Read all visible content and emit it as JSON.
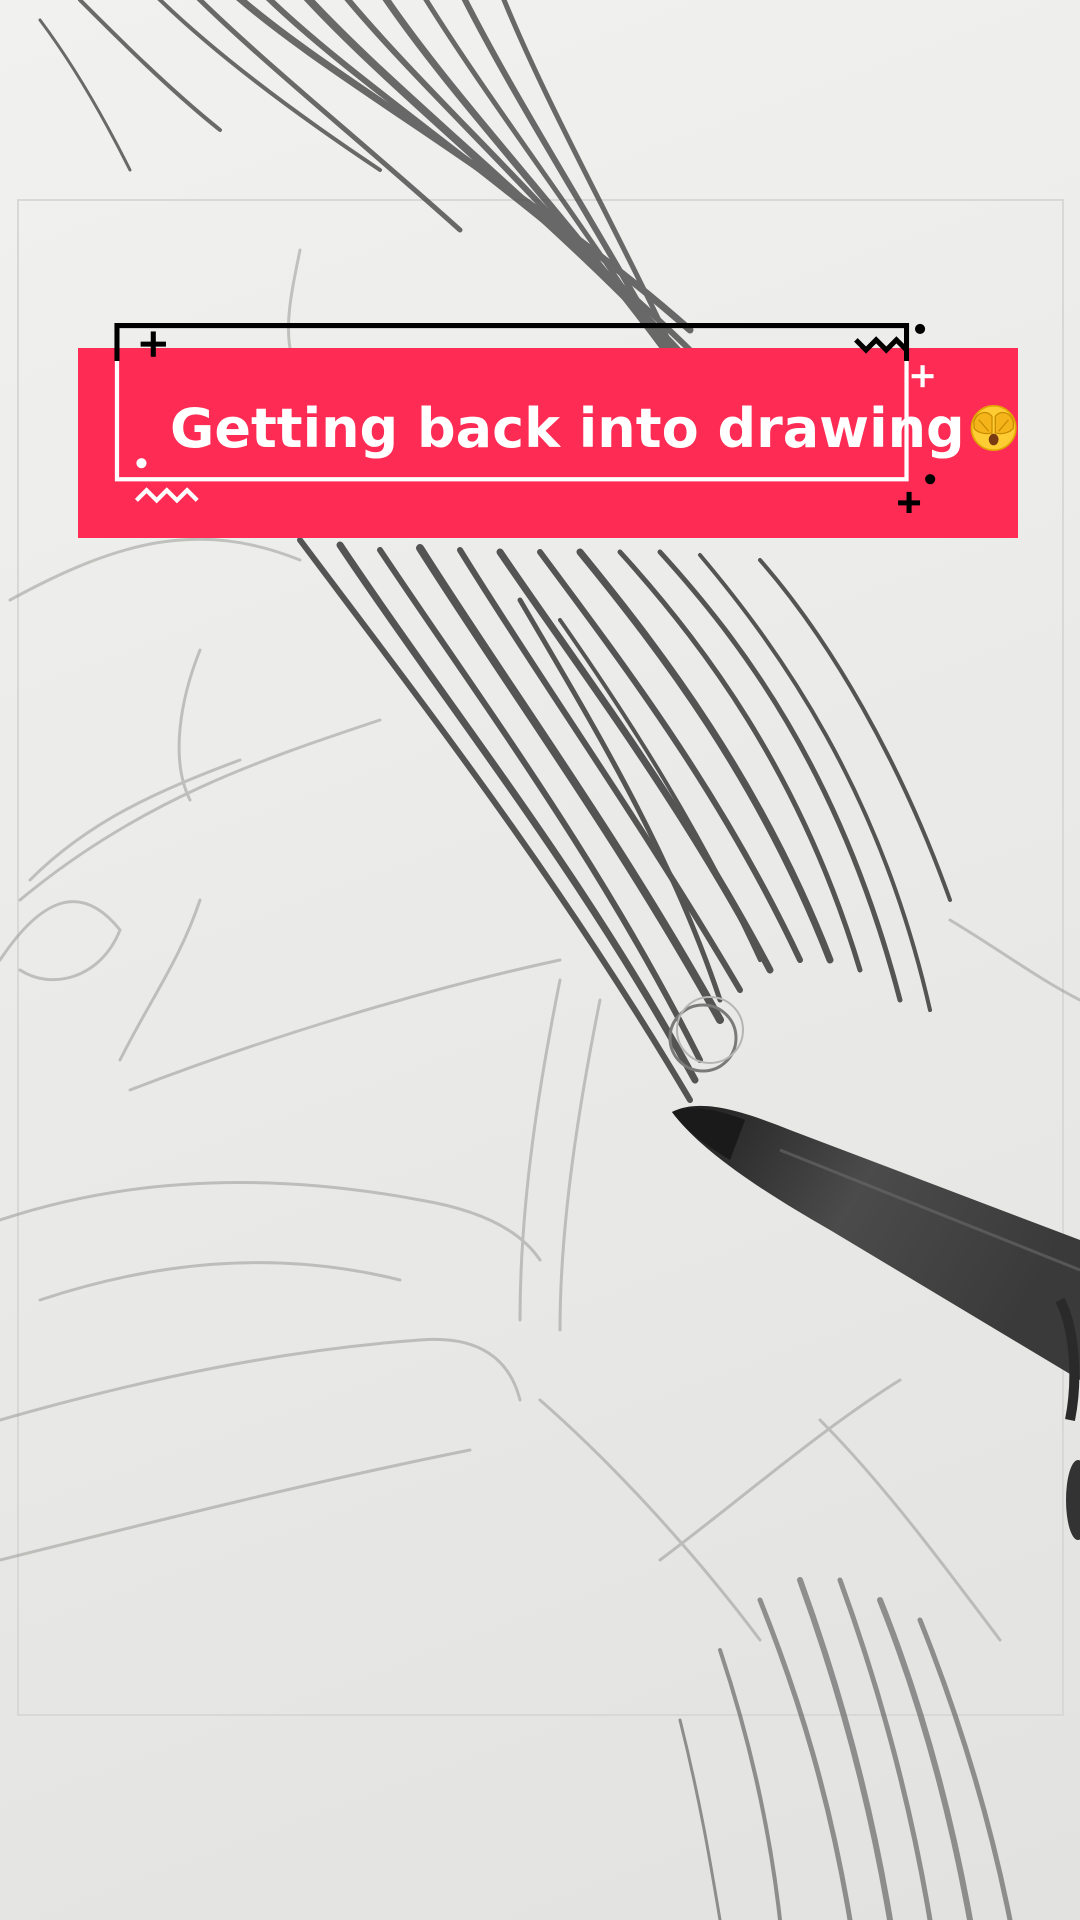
{
  "caption": {
    "text": "Getting back into drawing",
    "emoji_icon": "face-with-hands-over-eyes-icon"
  },
  "colors": {
    "caption_background": "#fe2c55",
    "caption_text": "#ffffff",
    "frame_outline": "#000000",
    "paper": "#ececea",
    "pencil_graphite": "#4a4a4a"
  }
}
